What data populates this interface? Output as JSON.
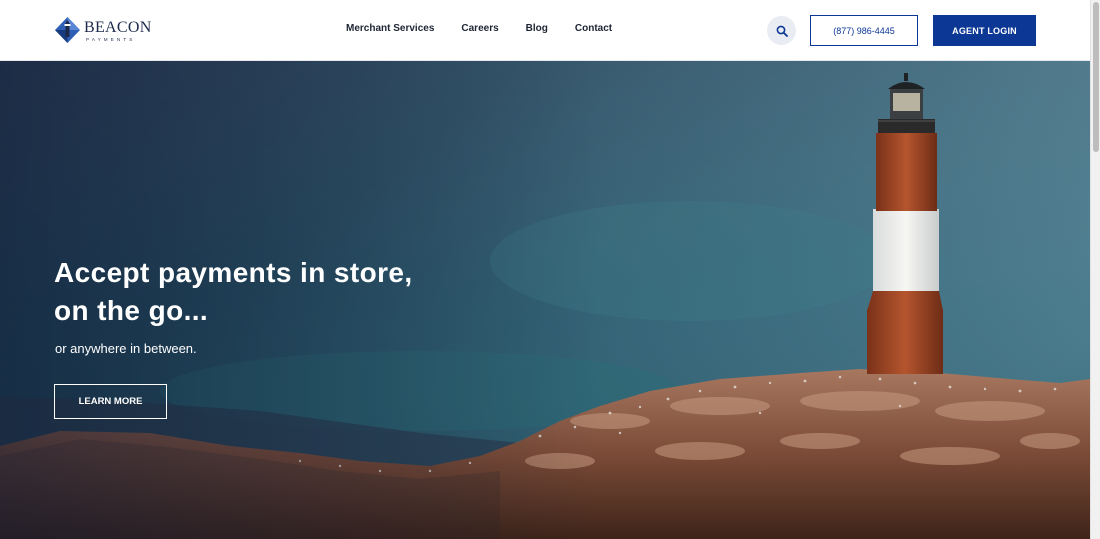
{
  "brand": {
    "name": "BEACON",
    "tagline": "PAYMENTS",
    "primary_color": "#0c3795",
    "logo_icon": "beacon-diamond-logo"
  },
  "nav": {
    "items": [
      {
        "label": "Merchant Services"
      },
      {
        "label": "Careers"
      },
      {
        "label": "Blog"
      },
      {
        "label": "Contact"
      }
    ]
  },
  "header": {
    "search_icon": "search-icon",
    "phone_label": "(877) 986-4445",
    "login_label": "AGENT LOGIN"
  },
  "hero": {
    "title_line1": "Accept payments in store,",
    "title_line2": "on the go...",
    "subtitle": "or anywhere in between.",
    "cta_label": "LEARN MORE",
    "image": "lighthouse-on-rocky-island"
  }
}
